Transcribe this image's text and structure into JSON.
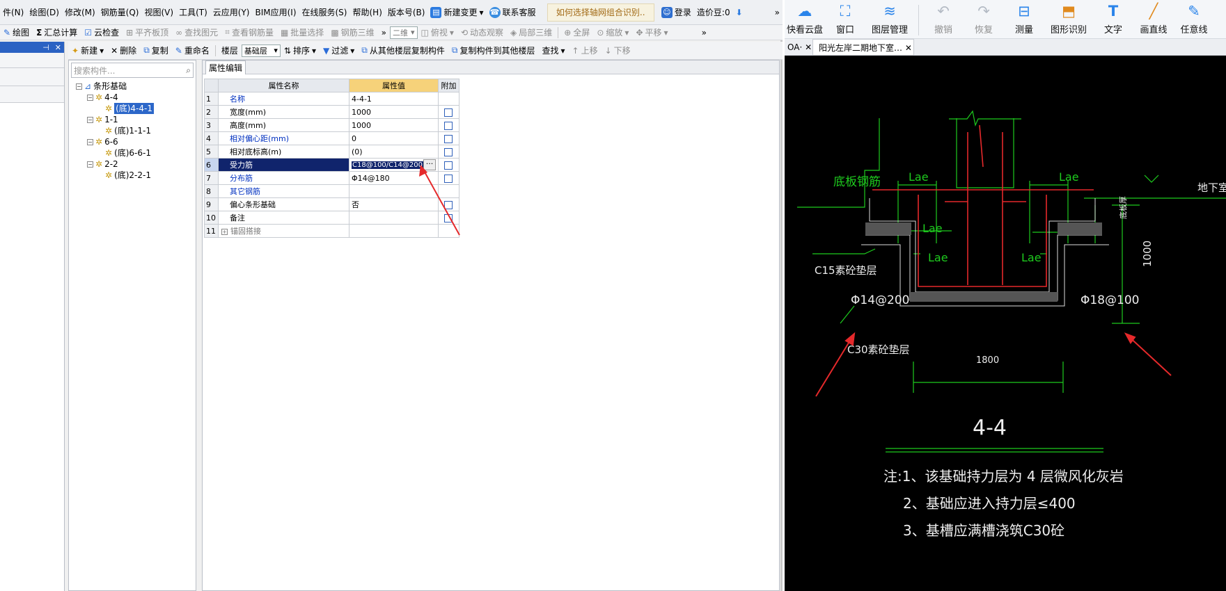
{
  "menu": {
    "items": [
      "件(N)",
      "绘图(D)",
      "修改(M)",
      "钢筋量(Q)",
      "视图(V)",
      "工具(T)",
      "云应用(Y)",
      "BIM应用(I)",
      "在线服务(S)",
      "帮助(H)",
      "版本号(B)"
    ],
    "new_change": "新建变更",
    "contact": "联系客服",
    "question_tab": "如何选择轴网组合识别..",
    "login": "登录",
    "price_label": "造价豆:0"
  },
  "toolbar1": {
    "draw": "绘图",
    "sum": "汇总计算",
    "cloud_check": "云检查",
    "flat_top": "平齐板顶",
    "find_element": "查找图元",
    "view_rebar": "查看钢筋量",
    "batch_select": "批量选择",
    "rebar_3d": "钢筋三维",
    "view_mode": "二维",
    "top_view": "俯视",
    "dynamic_observe": "动态观察",
    "local_3d": "局部三维",
    "fullscreen": "全屏",
    "zoom": "缩放",
    "pan": "平移"
  },
  "toolbar2": {
    "new": "新建",
    "delete": "删除",
    "copy": "复制",
    "rename": "重命名",
    "floor_label": "楼层",
    "floor_value": "基础层",
    "sort": "排序",
    "filter": "过滤",
    "copy_from": "从其他楼层复制构件",
    "copy_to": "复制构件到其他楼层",
    "find": "查找",
    "move_up": "上移",
    "move_down": "下移"
  },
  "tree": {
    "search_placeholder": "搜索构件...",
    "root": "条形基础",
    "groups": [
      {
        "name": "4-4",
        "child": "(底)4-4-1"
      },
      {
        "name": "1-1",
        "child": "(底)1-1-1"
      },
      {
        "name": "6-6",
        "child": "(底)6-6-1"
      },
      {
        "name": "2-2",
        "child": "(底)2-2-1"
      }
    ]
  },
  "props": {
    "tab": "属性编辑",
    "headers": [
      "属性名称",
      "属性值",
      "附加"
    ],
    "rows": [
      {
        "n": "1",
        "name": "名称",
        "value": "4-4-1",
        "blue": true,
        "check": false
      },
      {
        "n": "2",
        "name": "宽度(mm)",
        "value": "1000",
        "blue": false,
        "check": true
      },
      {
        "n": "3",
        "name": "高度(mm)",
        "value": "1000",
        "blue": false,
        "check": true
      },
      {
        "n": "4",
        "name": "相对偏心距(mm)",
        "value": "0",
        "blue": true,
        "check": true
      },
      {
        "n": "5",
        "name": "相对底标高(m)",
        "value": "(0)",
        "blue": false,
        "check": true
      },
      {
        "n": "6",
        "name": "受力筋",
        "value": "C18@100/C14@200",
        "blue": false,
        "check": true
      },
      {
        "n": "7",
        "name": "分布筋",
        "value": "Φ14@180",
        "blue": true,
        "check": true
      },
      {
        "n": "8",
        "name": "其它钢筋",
        "value": "",
        "blue": true,
        "check": false
      },
      {
        "n": "9",
        "name": "偏心条形基础",
        "value": "否",
        "blue": false,
        "check": true
      },
      {
        "n": "10",
        "name": "备注",
        "value": "",
        "blue": false,
        "check": true
      },
      {
        "n": "11",
        "name": "锚固搭接",
        "value": "",
        "blue": false,
        "check": false
      }
    ]
  },
  "viewer": {
    "tools": [
      "快看云盘",
      "窗口",
      "图层管理",
      "撤销",
      "恢复",
      "测量",
      "图形识别",
      "文字",
      "画直线",
      "任意线"
    ],
    "tab_short": "OA·",
    "tab_doc": "阳光左岸二期地下室…"
  },
  "drawing": {
    "bottom_rebar": "底板钢筋",
    "lae": "Lae",
    "basement_floor": "地下室底板面",
    "c15": "C15素砼垫层",
    "c30": "C30素砼垫层",
    "rebar_left": "Φ14@200",
    "rebar_right": "Φ18@100",
    "dim_1000": "1000",
    "dim_1800": "1800",
    "plate_thick": "底板厚",
    "section": "4-4",
    "note1": "注:1、该基础持力层为 4  层微风化灰岩",
    "note2": "2、基础应进入持力层≤400",
    "note3": "3、基槽应满槽浇筑C30砼"
  },
  "colors": {
    "selection": "#10246c",
    "value_header": "#f6d27a",
    "cad_green": "#1ecb1e",
    "cad_red": "#e5292b"
  }
}
